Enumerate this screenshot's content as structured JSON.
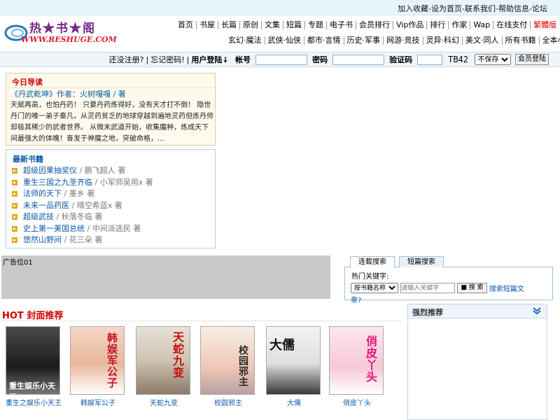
{
  "topbar": {
    "links": [
      "加入收藏",
      "设为首页",
      "联系我们",
      "帮助信息",
      "论坛"
    ],
    "separator": " - "
  },
  "logo": {
    "title": "热★书★阁",
    "url": "WWW.RESHUGE.COM"
  },
  "nav": {
    "row1": [
      "首页",
      "书屋",
      "长篇",
      "原创",
      "文集",
      "短篇",
      "专题",
      "电子书",
      "会员排行",
      "Vip作品",
      "排行",
      "作家",
      "Wap",
      "在线支付",
      "繁體版"
    ],
    "row2": [
      "玄幻·魔法",
      "武侠·仙侠",
      "都市·言情",
      "历史·军事",
      "网游·竞技",
      "灵异·科幻",
      "美文·同人",
      "所有书籍",
      "全本小说"
    ]
  },
  "login": {
    "register": "还没注册?",
    "forgot": "忘记密码!",
    "member_login": "用户登陆↓",
    "account_label": "帐号",
    "password_label": "密码",
    "captcha_label": "验证码",
    "captcha_value": "TB42",
    "remember_option": "不保存",
    "submit": "会员登陆"
  },
  "today": {
    "title": "今日导读",
    "book": "《丹武乾坤》作者：火树嘎嘎 / 著",
    "description": "天赋再高，也怕丹药！ 只要丹药炼得好，没有天才打不倒！ 隐世丹门的唯一弟子秦凡，从灵药贫乏的地球穿越到遍地灵药但炼丹师却极其稀少的武者世界。 从微末武道开始，收集魔种，炼成天下间最强大的体魄！奋发于神魔之地，突破命格，..."
  },
  "latest": {
    "title": "最新书籍",
    "items": [
      {
        "title": "超级因果抽奖仪",
        "author": "/ 鹏飞超人 著"
      },
      {
        "title": "重生三国之九圣齐临",
        "author": "/ 小军师吴用x 著"
      },
      {
        "title": "法师的天下",
        "author": "/ 墨乡 著"
      },
      {
        "title": "未来一品药医",
        "author": "/ 晴空希蓝x 著"
      },
      {
        "title": "超级武技",
        "author": "/ 秋落冬临 著"
      },
      {
        "title": "史上第一美国总统",
        "author": "/ 中间派选民 著"
      },
      {
        "title": "悠然山野间",
        "author": "/ 花三朵 著"
      }
    ]
  },
  "ad": {
    "label": "广告位01"
  },
  "search": {
    "tabs": [
      "连载搜索",
      "短篇搜索"
    ],
    "hot_label": "热门关键字:",
    "field_option": "按书籍名称",
    "placeholder": "请输入关键字",
    "button": "搜 索",
    "short_link_a": "搜索短篇文",
    "short_link_b": "章?"
  },
  "hot": {
    "title": "HOT 封面推荐",
    "covers": [
      {
        "caption": "重生之娱乐小天王",
        "art": "重生娱乐小天王"
      },
      {
        "caption": "韩娱军公子",
        "art": "韩娱军公子"
      },
      {
        "caption": "天蛇九变",
        "art": "天蛇九变"
      },
      {
        "caption": "校园邪主",
        "art": "校园邪主"
      },
      {
        "caption": "大儒",
        "art": "大儒"
      },
      {
        "caption": "俏皮丫头",
        "art": "俏皮丫头"
      }
    ]
  },
  "strong": {
    "title": "强烈推荐"
  },
  "colors": {
    "accent_red": "#d40000",
    "link_blue": "#0b5aa8",
    "logo_purple": "#7a2c8c"
  }
}
